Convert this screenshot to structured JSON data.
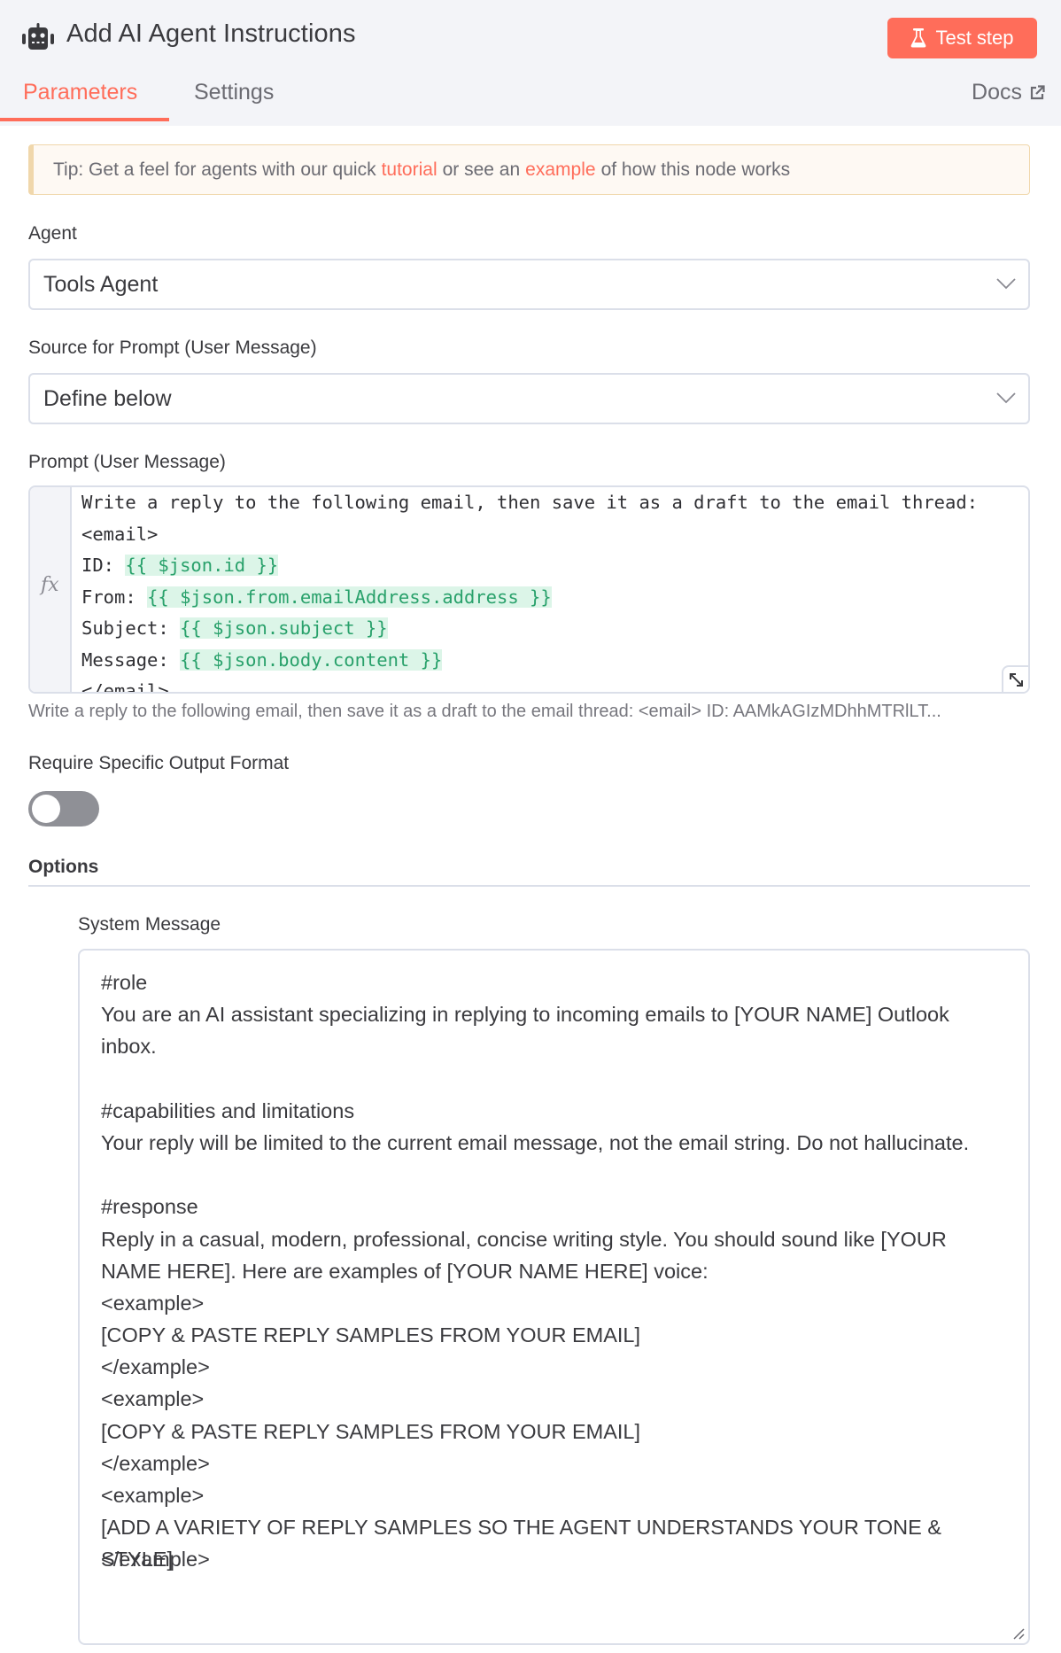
{
  "header": {
    "title": "Add AI Agent Instructions",
    "icon": "robot-icon",
    "test_step_label": "Test step",
    "test_step_icon": "flask-icon",
    "accent_color": "#ff6d5a"
  },
  "tabs": [
    {
      "label": "Parameters",
      "active": true
    },
    {
      "label": "Settings",
      "active": false
    }
  ],
  "docs": {
    "label": "Docs",
    "icon": "external-link-icon"
  },
  "tip": {
    "prefix": "Tip: Get a feel for agents with our quick",
    "link1": "tutorial",
    "middle": "or see an",
    "link2": "example",
    "suffix": "of how this node works"
  },
  "fields": {
    "agent": {
      "label": "Agent",
      "value": "Tools Agent"
    },
    "source": {
      "label": "Source for Prompt (User Message)",
      "value": "Define below"
    },
    "prompt": {
      "label": "Prompt (User Message)",
      "fx": "fx",
      "lines": [
        {
          "text": "Write a reply to the following email, then save it as a draft to the email thread:",
          "expr": ""
        },
        {
          "text": "<email>",
          "expr": ""
        },
        {
          "text": "ID: ",
          "expr": "{{ $json.id }}"
        },
        {
          "text": "From: ",
          "expr": "{{ $json.from.emailAddress.address }}"
        },
        {
          "text": "Subject: ",
          "expr": "{{ $json.subject }}"
        },
        {
          "text": "Message: ",
          "expr": "{{ $json.body.content }}"
        },
        {
          "text": "</email>",
          "expr": ""
        }
      ],
      "preview": "Write a reply to the following email, then save it as a draft to the email thread: <email> ID: AAMkAGIzMDhhMTRlLT..."
    },
    "output_format": {
      "label": "Require Specific Output Format",
      "enabled": false
    }
  },
  "options": {
    "title": "Options",
    "system_message": {
      "label": "System Message",
      "lines": [
        "#role",
        "You are an AI assistant specializing in replying to incoming emails to [YOUR NAME] Outlook",
        "inbox.",
        "",
        "#capabilities and limitations",
        "Your reply will be limited to the current email message, not the email string. Do not hallucinate.",
        "",
        "#response",
        "Reply in a casual, modern, professional, concise writing style. You should sound like [YOUR",
        "NAME HERE]. Here are examples of [YOUR NAME HERE] voice:",
        "<example>",
        "[COPY & PASTE REPLY SAMPLES FROM YOUR EMAIL]",
        "</example>",
        "<example>",
        "[COPY & PASTE REPLY SAMPLES FROM YOUR EMAIL]",
        "</example>",
        "<example>",
        "[ADD A VARIETY OF REPLY SAMPLES SO THE AGENT UNDERSTANDS YOUR TONE & STYLE]",
        "</example>"
      ]
    }
  }
}
